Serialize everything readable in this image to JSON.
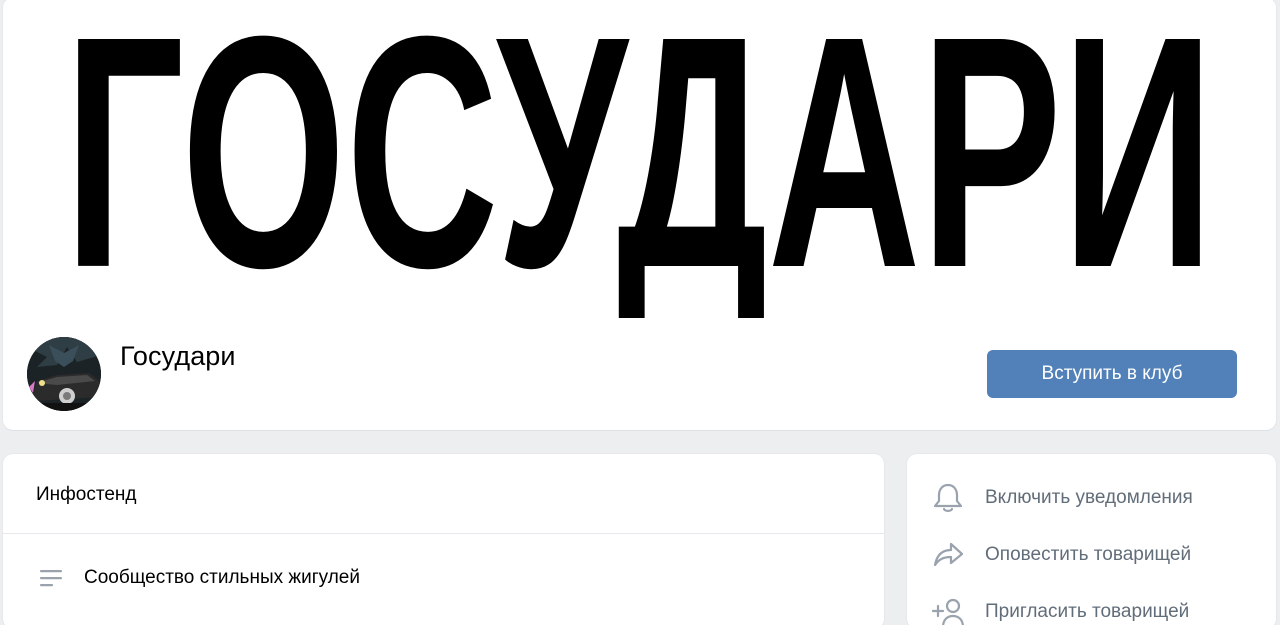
{
  "header": {
    "cover_text": "ГОСУДАРИ",
    "group_name": "Государи",
    "join_label": "Вступить в клуб"
  },
  "colors": {
    "accent": "#5181b8",
    "background": "#edeef0",
    "secondary_text": "#626d7a",
    "icon": "#99a2ad"
  },
  "infostand": {
    "title": "Инфостенд",
    "description": "Сообщество стильных жигулей"
  },
  "actions": {
    "items": [
      {
        "label": "Включить уведомления",
        "icon": "bell-icon"
      },
      {
        "label": "Оповестить товарищей",
        "icon": "share-arrow-icon"
      },
      {
        "label": "Пригласить товарищей",
        "icon": "add-user-icon"
      }
    ]
  }
}
